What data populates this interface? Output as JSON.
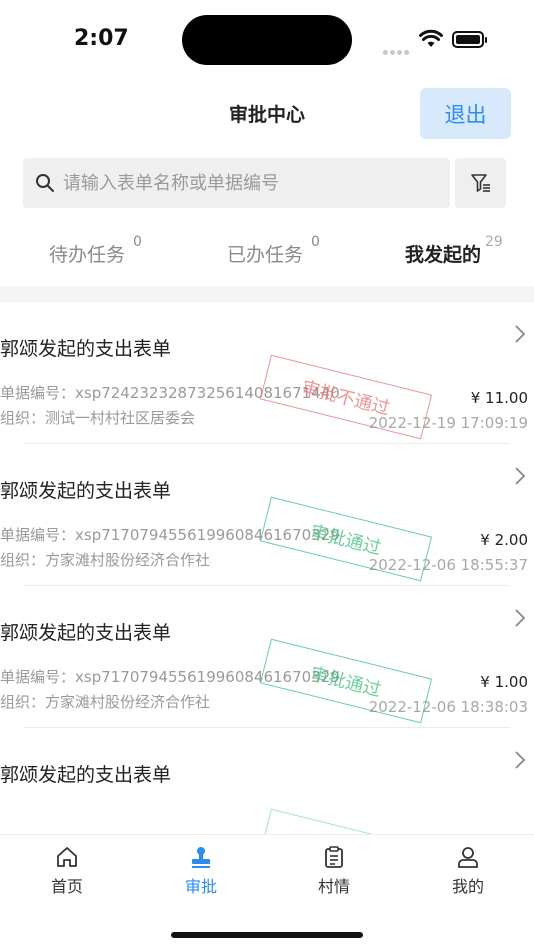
{
  "status_bar": {
    "time": "2:07"
  },
  "header": {
    "title": "审批中心",
    "logout_label": "退出"
  },
  "search": {
    "placeholder": "请输入表单名称或单据编号"
  },
  "tabs": [
    {
      "label": "待办任务",
      "count": "0"
    },
    {
      "label": "已办任务",
      "count": "0"
    },
    {
      "label": "我发起的",
      "count": "29"
    }
  ],
  "list": [
    {
      "title": "郭颂发起的支出表单",
      "doc_no": "单据编号：xsp7242323287325614081671440",
      "org": "组织：测试一村村社区居委会",
      "amount": "¥ 11.00",
      "date": "2022-12-19 17:09:19",
      "stamp": "审批不通过"
    },
    {
      "title": "郭颂发起的支出表单",
      "doc_no": "单据编号：xsp7170794556199608461670329",
      "org": "组织：方家滩村股份经济合作社",
      "amount": "¥ 2.00",
      "date": "2022-12-06 18:55:37",
      "stamp": "审批通过"
    },
    {
      "title": "郭颂发起的支出表单",
      "doc_no": "单据编号：xsp7170794556199608461670329",
      "org": "组织：方家滩村股份经济合作社",
      "amount": "¥ 1.00",
      "date": "2022-12-06 18:38:03",
      "stamp": "审批通过"
    },
    {
      "title": "郭颂发起的支出表单"
    }
  ],
  "bottom_nav": [
    {
      "label": "首页",
      "icon": "home-icon"
    },
    {
      "label": "审批",
      "icon": "stamp-icon"
    },
    {
      "label": "村情",
      "icon": "clipboard-icon"
    },
    {
      "label": "我的",
      "icon": "user-icon"
    }
  ],
  "colors": {
    "accent": "#2d8cf0",
    "rejected": "#e57373",
    "approved": "#3cbf7a"
  }
}
